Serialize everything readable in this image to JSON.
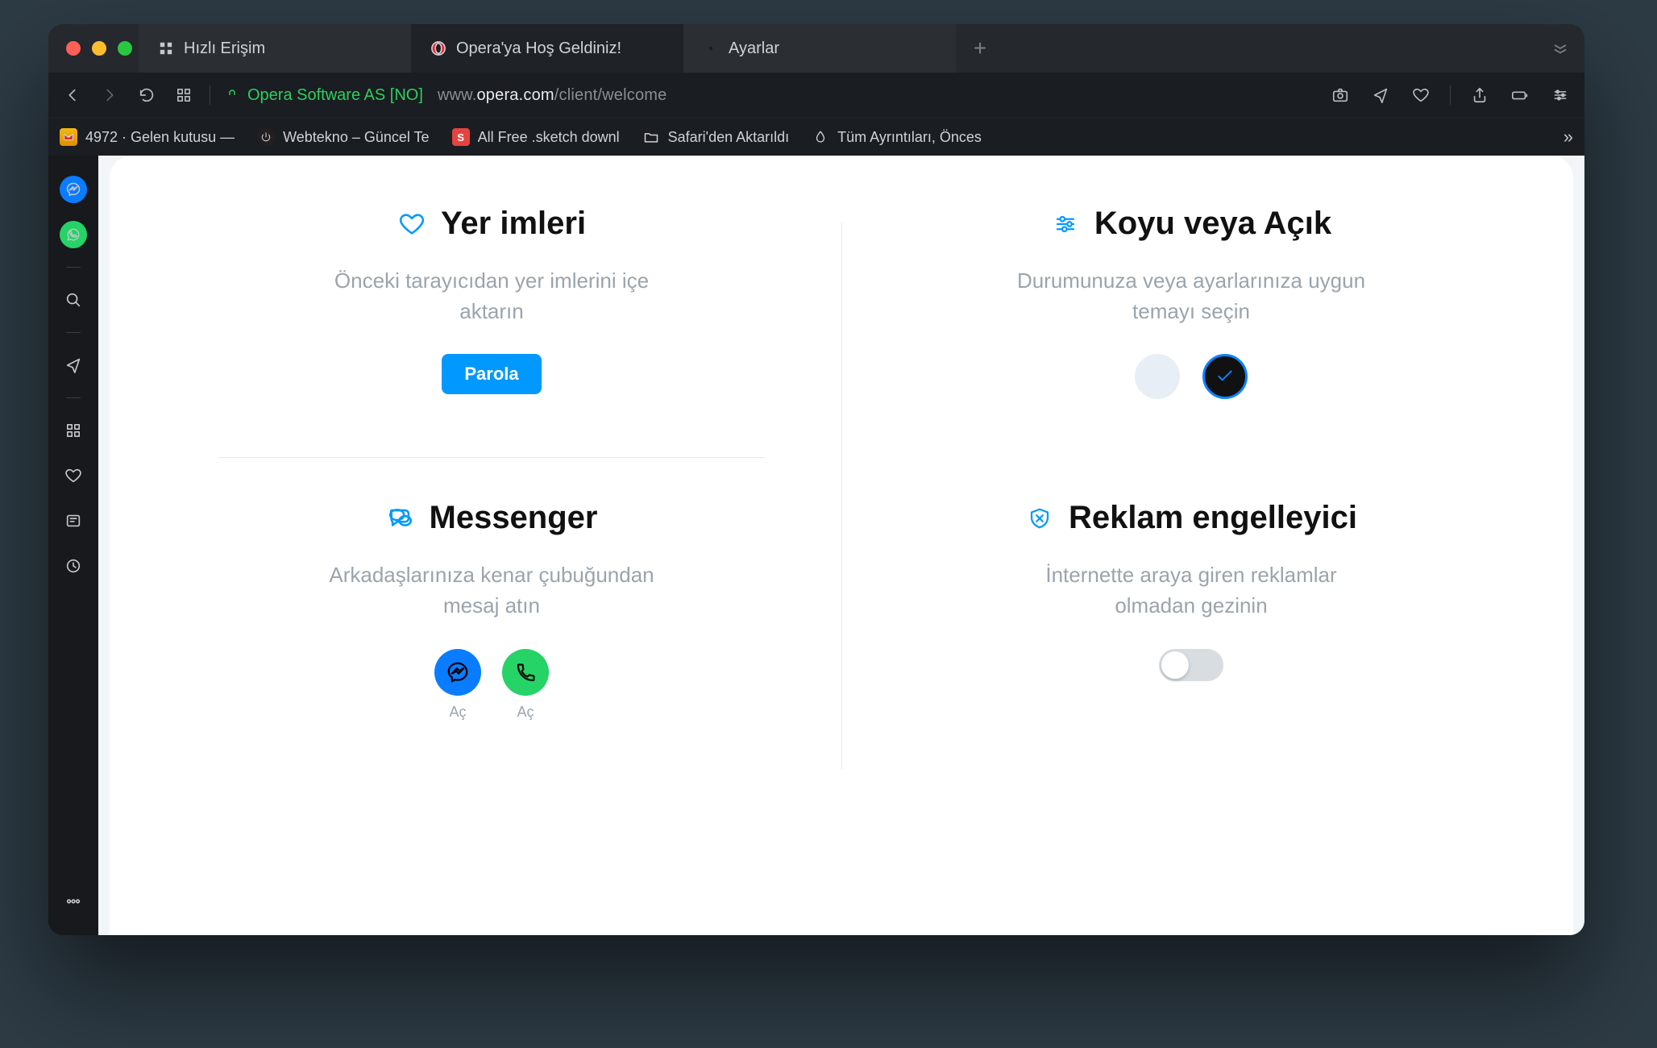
{
  "tabs": [
    {
      "label": "Hızlı Erişim",
      "icon": "speed-dial"
    },
    {
      "label": "Opera'ya Hoş Geldiniz!",
      "icon": "opera",
      "active": true
    },
    {
      "label": "Ayarlar",
      "icon": "gear"
    }
  ],
  "addressbar": {
    "security_badge": "Opera Software AS [NO]",
    "url_prefix": "www.",
    "url_host": "opera.com",
    "url_path": "/client/welcome"
  },
  "bookmarks": [
    {
      "label": "4972 · Gelen kutusu —",
      "fav_bg": "#f2b90f",
      "fav_icon": "gmail"
    },
    {
      "label": "Webtekno – Güncel Te",
      "fav_bg": "#231f20",
      "fav_icon": "power-red"
    },
    {
      "label": "All Free .sketch downl",
      "fav_bg": "#e5433f",
      "fav_icon": "sketch"
    },
    {
      "label": "Safari'den Aktarıldı",
      "fav_bg": "transparent",
      "fav_icon": "folder"
    },
    {
      "label": "Tüm Ayrıntıları, Önces",
      "fav_bg": "#0aa3d8",
      "fav_icon": "drop"
    }
  ],
  "sidebar": {
    "messenger_icon": "messenger",
    "whatsapp_icon": "whatsapp"
  },
  "welcome": {
    "bookmarks": {
      "title": "Yer imleri",
      "subtitle": "Önceki tarayıcıdan yer imlerini içe aktarın",
      "button": "Parola"
    },
    "theme": {
      "title": "Koyu veya Açık",
      "subtitle": "Durumunuza veya ayarlarınıza uygun temayı seçin"
    },
    "messenger": {
      "title": "Messenger",
      "subtitle": "Arkadaşlarınıza kenar çubuğundan mesaj atın",
      "caption": "Aç"
    },
    "adblock": {
      "title": "Reklam engelleyici",
      "subtitle": "İnternette araya giren reklamlar olmadan gezinin"
    }
  }
}
